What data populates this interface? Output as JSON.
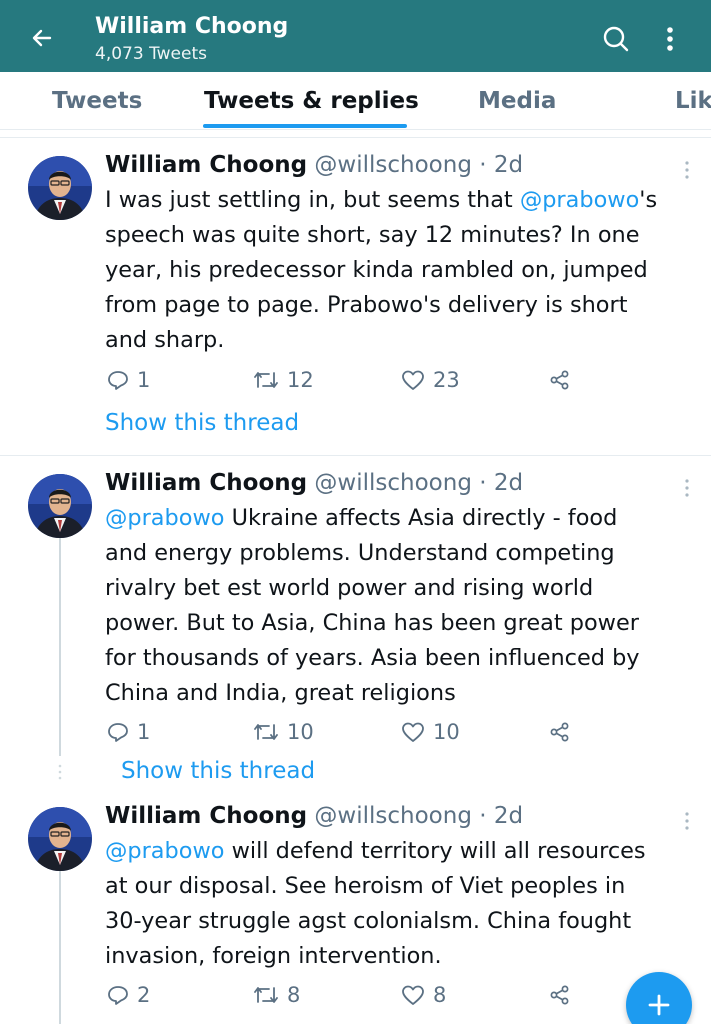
{
  "header": {
    "name": "William Choong",
    "tweet_count": "4,073 Tweets",
    "bg_color": "#26797f",
    "back_icon": "arrow-left-icon",
    "search_icon": "search-icon",
    "more_icon": "more-vertical-icon"
  },
  "tabs": [
    {
      "label": "Tweets"
    },
    {
      "label": "Tweets & replies",
      "active": true
    },
    {
      "label": "Media"
    },
    {
      "label": "Lik"
    }
  ],
  "tweets": [
    {
      "name": "William Choong",
      "handle": "@willschoong",
      "dot": "·",
      "time": "2d",
      "text_lines": [
        [
          {
            "t": "I was just settling in, but seems that "
          },
          {
            "t": "@prabowo",
            "m": true
          },
          {
            "t": "'s"
          }
        ],
        [
          {
            "t": "speech was quite short, say 12 minutes? In one"
          }
        ],
        [
          {
            "t": "year, his predecessor kinda rambled on, jumped"
          }
        ],
        [
          {
            "t": "from page to page. Prabowo's delivery is short"
          }
        ],
        [
          {
            "t": "and sharp."
          }
        ]
      ],
      "replies": "1",
      "retweets": "12",
      "likes": "23",
      "show_thread": "Show this thread"
    },
    {
      "name": "William Choong",
      "handle": "@willschoong",
      "dot": "·",
      "time": "2d",
      "text_lines": [
        [
          {
            "t": "@prabowo",
            "m": true
          },
          {
            "t": " Ukraine affects Asia directly - food"
          }
        ],
        [
          {
            "t": "and energy problems. Understand competing"
          }
        ],
        [
          {
            "t": "rivalry bet est world power and rising world"
          }
        ],
        [
          {
            "t": "power. But to Asia, China has been great power"
          }
        ],
        [
          {
            "t": "for thousands of years. Asia been influenced by"
          }
        ],
        [
          {
            "t": "China and India, great religions"
          }
        ]
      ],
      "replies": "1",
      "retweets": "10",
      "likes": "10",
      "show_thread": "Show this thread"
    },
    {
      "name": "William Choong",
      "handle": "@willschoong",
      "dot": "·",
      "time": "2d",
      "text_lines": [
        [
          {
            "t": "@prabowo",
            "m": true
          },
          {
            "t": " will defend territory will all resources"
          }
        ],
        [
          {
            "t": "at our disposal. See heroism of Viet peoples in"
          }
        ],
        [
          {
            "t": "30-year struggle agst colonialsm. China fought"
          }
        ],
        [
          {
            "t": "invasion, foreign intervention."
          }
        ]
      ],
      "replies": "2",
      "retweets": "8",
      "likes": "8"
    }
  ],
  "fab_icon": "plus-icon",
  "accent_color": "#1d9bf0"
}
